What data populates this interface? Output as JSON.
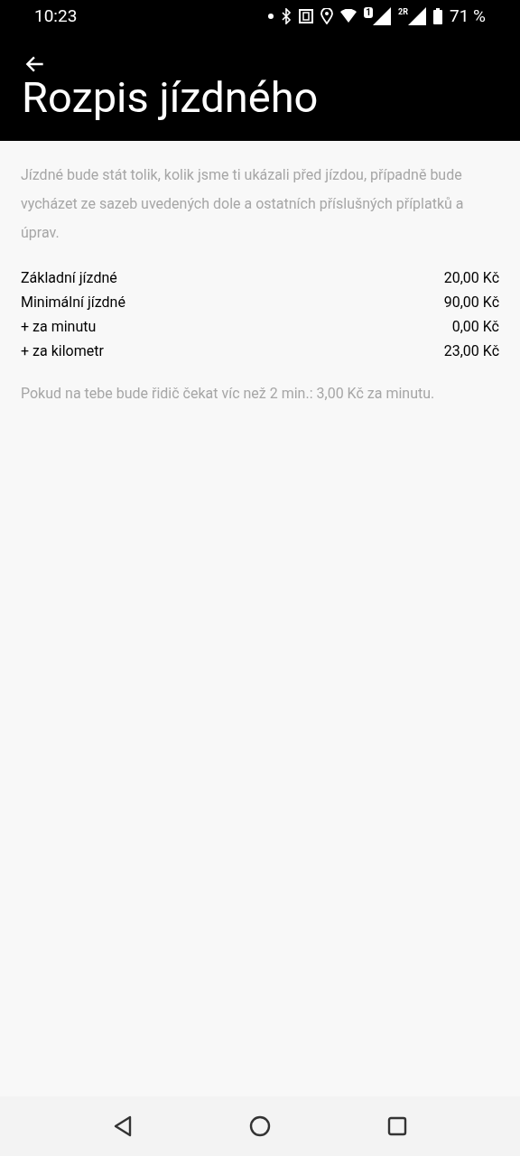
{
  "status_bar": {
    "time": "10:23",
    "sim_1": "1",
    "sim_2": "2R",
    "battery": "71 %"
  },
  "header": {
    "title": "Rozpis jízdného"
  },
  "intro": "Jízdné bude stát tolik, kolik jsme ti ukázali před jízdou, případně bude vycházet ze sazeb uvedených dole a ostatních příslušných příplatků a úprav.",
  "fares": [
    {
      "label": "Základní jízdné",
      "value": "20,00 Kč"
    },
    {
      "label": "Minimální jízdné",
      "value": "90,00 Kč"
    },
    {
      "label": "+ za minutu",
      "value": "0,00 Kč"
    },
    {
      "label": "+ za kilometr",
      "value": "23,00 Kč"
    }
  ],
  "note": "Pokud na tebe bude řidič čekat víc než 2 min.: 3,00 Kč za minutu."
}
